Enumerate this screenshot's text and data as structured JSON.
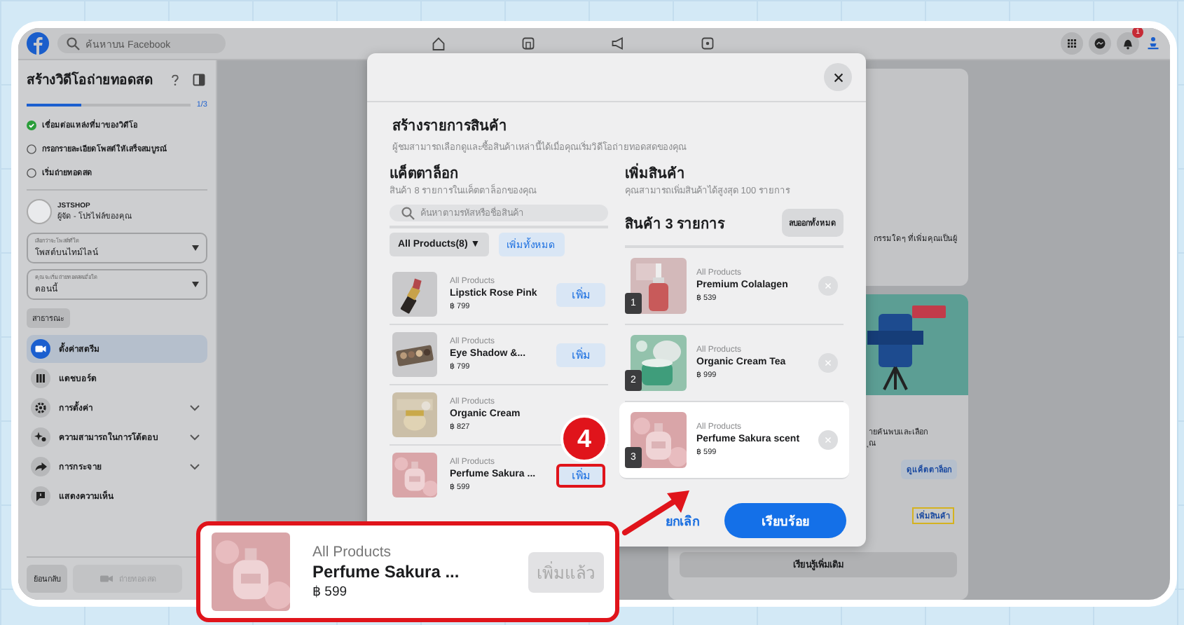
{
  "topbar": {
    "search_placeholder": "ค้นหาบน Facebook",
    "notification_count": "1"
  },
  "sidebar": {
    "title": "สร้างวิดีโอถ่ายทอดสด",
    "progress": {
      "level": 0.33,
      "reading": "1/3"
    },
    "steps": [
      {
        "label": "เชื่อมต่อแหล่งที่มาของวิดีโอ",
        "checked": true
      },
      {
        "label": "กรอกรายละเอียดโพสต์ให้เสร็จสมบูรณ์",
        "checked": false
      },
      {
        "label": "เริ่มถ่ายทอดสด",
        "checked": false
      }
    ],
    "page": {
      "name": "JSTSHOP",
      "role": "ผู้จัด - โปรไฟล์ของคุณ"
    },
    "selects": [
      {
        "label": "เลือกว่าจะโพสต์ที่ใด",
        "value": "โพสต์บนไทม์ไลน์"
      },
      {
        "label": "คุณจะเริ่มถ่ายทอดสดเมื่อใด",
        "value": "ตอนนี้"
      }
    ],
    "audience": "สาธารณะ",
    "nav": [
      {
        "label": "ตั้งค่าสตรีม",
        "selected": true,
        "expandable": false
      },
      {
        "label": "แดชบอร์ด",
        "selected": false,
        "expandable": false
      },
      {
        "label": "การตั้งค่า",
        "selected": false,
        "expandable": true
      },
      {
        "label": "ความสามารถในการโต้ตอบ",
        "selected": false,
        "expandable": true
      },
      {
        "label": "การกระจาย",
        "selected": false,
        "expandable": true
      },
      {
        "label": "แสดงความเห็น",
        "selected": false,
        "expandable": false
      }
    ],
    "back": "ย้อนกลับ",
    "go_live": {
      "label": "ถ่ายทอดสด",
      "disabled": true
    }
  },
  "background": {
    "card_text": "กรรมใดๆ ที่เพิ่มคุณเป็นผู้",
    "promo_lines": [
      "ายค้นพบและเลือก",
      "ุณ"
    ],
    "view_catalog": "ดูแค็ตตาล็อก",
    "add_products": "เพิ่มสินค้า",
    "learn_more": "เรียนรู้เพิ่มเติม"
  },
  "modal": {
    "title": "สร้างรายการสินค้า",
    "subtitle": "ผู้ชมสามารถเลือกดูและซื้อสินค้าเหล่านี้ได้เมื่อคุณเริ่มวิดีโอถ่ายทอดสดของคุณ",
    "catalog": {
      "title": "แค็ตตาล็อก",
      "subtitle": "สินค้า 8 รายการในแค็ตตาล็อกของคุณ",
      "search_placeholder": "ค้นหาตามรหัสหรือชื่อสินค้า",
      "filter": "All Products(8) ▼",
      "add_all": "เพิ่มทั้งหมด",
      "items": [
        {
          "category": "All Products",
          "name": "Lipstick Rose Pink",
          "price": "฿ 799",
          "button": "เพิ่ม",
          "highlighted": false
        },
        {
          "category": "All Products",
          "name": "Eye Shadow &...",
          "price": "฿ 799",
          "button": "เพิ่ม",
          "highlighted": false
        },
        {
          "category": "All Products",
          "name": "Organic Cream",
          "price": "฿ 827"
        },
        {
          "category": "All Products",
          "name": "Perfume Sakura ...",
          "price": "฿ 599",
          "button": "เพิ่ม",
          "highlighted": true
        }
      ]
    },
    "added": {
      "title": "เพิ่มสินค้า",
      "subtitle": "คุณสามารถเพิ่มสินค้าได้สูงสุด 100 รายการ",
      "count": "สินค้า 3 รายการ",
      "remove_all": "ลบออกทั้งหมด",
      "items": [
        {
          "number": "1",
          "category": "All Products",
          "name": "Premium Colalagen",
          "price": "฿ 539",
          "highlighted": false
        },
        {
          "number": "2",
          "category": "All Products",
          "name": "Organic Cream Tea",
          "price": "฿ 999",
          "highlighted": false
        },
        {
          "number": "3",
          "category": "All Products",
          "name": "Perfume Sakura scent",
          "price": "฿ 599",
          "highlighted": true
        }
      ]
    },
    "cancel": "ยกเลิก",
    "done": "เรียบร้อย"
  },
  "callout": {
    "category": "All Products",
    "name": "Perfume Sakura ...",
    "price": "฿ 599",
    "button": "เพิ่มแล้ว",
    "disabled": true
  },
  "step_badge": "4"
}
